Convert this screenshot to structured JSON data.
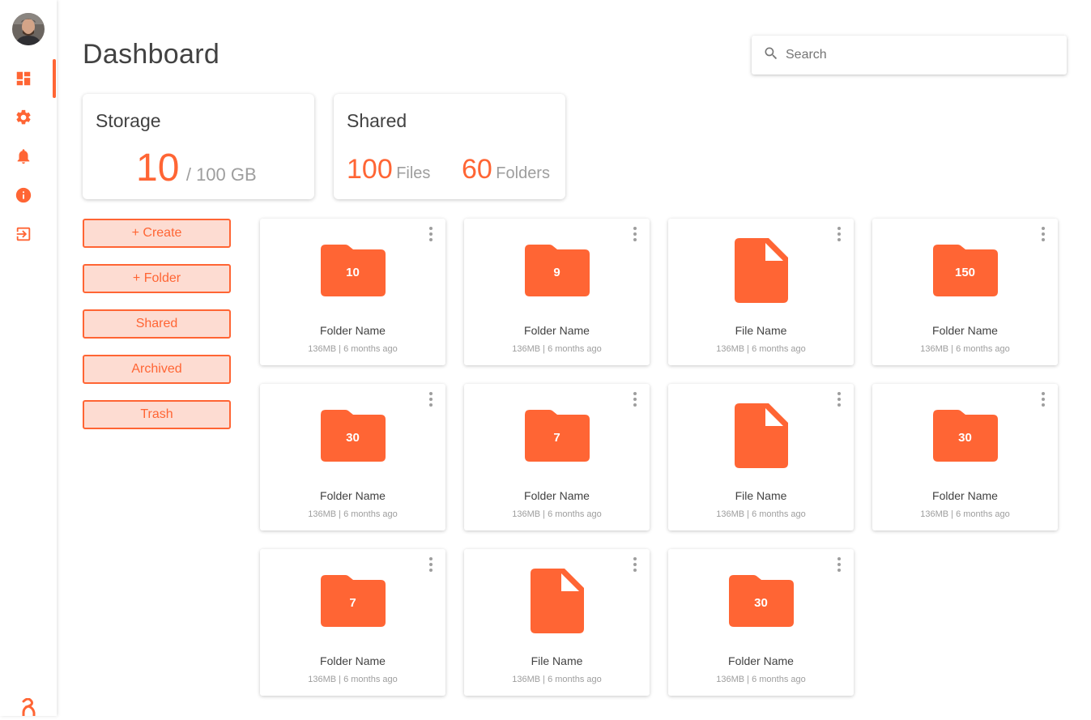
{
  "colors": {
    "accent": "#ff6534",
    "accent_light": "#fddcd2",
    "text": "#424242",
    "muted": "#9e9e9e"
  },
  "sidebar": {
    "items": [
      {
        "name": "dashboard",
        "icon": "dashboard-icon",
        "active": true
      },
      {
        "name": "settings",
        "icon": "gear-icon",
        "active": false
      },
      {
        "name": "notifications",
        "icon": "bell-icon",
        "active": false
      },
      {
        "name": "info",
        "icon": "info-icon",
        "active": false
      },
      {
        "name": "logout",
        "icon": "logout-icon",
        "active": false
      }
    ]
  },
  "header": {
    "title": "Dashboard"
  },
  "search": {
    "placeholder": "Search"
  },
  "storage": {
    "title": "Storage",
    "used": "10",
    "total": "/ 100 GB"
  },
  "shared": {
    "title": "Shared",
    "files_count": "100",
    "files_label": "Files",
    "folders_count": "60",
    "folders_label": "Folders"
  },
  "actions": [
    "+ Create",
    "+ Folder",
    "Shared",
    "Archived",
    "Trash"
  ],
  "tiles": [
    {
      "type": "folder",
      "count": "10",
      "name": "Folder Name",
      "meta": "136MB | 6 months ago"
    },
    {
      "type": "folder",
      "count": "9",
      "name": "Folder Name",
      "meta": "136MB | 6 months ago"
    },
    {
      "type": "file",
      "count": "",
      "name": "File Name",
      "meta": "136MB | 6 months ago"
    },
    {
      "type": "folder",
      "count": "150",
      "name": "Folder Name",
      "meta": "136MB | 6 months ago"
    },
    {
      "type": "folder",
      "count": "30",
      "name": "Folder Name",
      "meta": "136MB | 6 months ago"
    },
    {
      "type": "folder",
      "count": "7",
      "name": "Folder Name",
      "meta": "136MB | 6 months ago"
    },
    {
      "type": "file",
      "count": "",
      "name": "File Name",
      "meta": "136MB | 6 months ago"
    },
    {
      "type": "folder",
      "count": "30",
      "name": "Folder Name",
      "meta": "136MB | 6 months ago"
    },
    {
      "type": "folder",
      "count": "7",
      "name": "Folder Name",
      "meta": "136MB | 6 months ago"
    },
    {
      "type": "file",
      "count": "",
      "name": "File Name",
      "meta": "136MB | 6 months ago"
    },
    {
      "type": "folder",
      "count": "30",
      "name": "Folder Name",
      "meta": "136MB | 6 months ago"
    }
  ]
}
